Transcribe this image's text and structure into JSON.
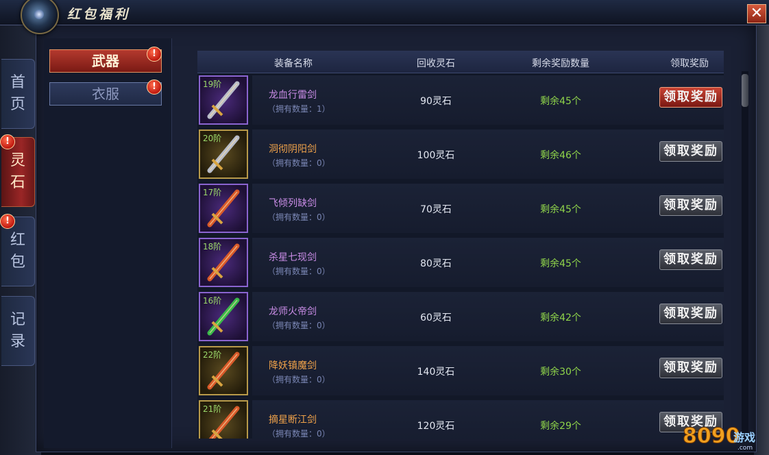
{
  "window": {
    "title": "红包福利",
    "close_label": "✕"
  },
  "side_tabs": [
    {
      "label_top": "首",
      "label_bottom": "页",
      "active": false,
      "badge": ""
    },
    {
      "label_top": "灵",
      "label_bottom": "石",
      "active": true,
      "badge": "!"
    },
    {
      "label_top": "红",
      "label_bottom": "包",
      "active": false,
      "badge": "!"
    },
    {
      "label_top": "记",
      "label_bottom": "录",
      "active": false,
      "badge": ""
    }
  ],
  "categories": {
    "weapon": {
      "label": "武器",
      "badge": "!"
    },
    "clothes": {
      "label": "衣服",
      "badge": "!"
    }
  },
  "table": {
    "headers": [
      "装备名称",
      "回收灵石",
      "剩余奖励数量",
      "领取奖励"
    ],
    "rows": [
      {
        "tier": "19阶",
        "name": "龙血行雷剑",
        "name_color": "#c98ce6",
        "owned": "（拥有数量：1）",
        "stone": "90灵石",
        "remain": "剩余45个",
        "claim": "领取奖励",
        "active": true,
        "frame": "purple"
      },
      {
        "tier": "20阶",
        "name": "洞彻阴阳剑",
        "name_color": "#f0a24a",
        "owned": "（拥有数量：0）",
        "stone": "100灵石",
        "remain": "剩余46个",
        "claim": "领取奖励",
        "active": false,
        "frame": "gold"
      },
      {
        "tier": "17阶",
        "name": "飞倾列缺剑",
        "name_color": "#c98ce6",
        "owned": "（拥有数量：0）",
        "stone": "70灵石",
        "remain": "剩余45个",
        "claim": "领取奖励",
        "active": false,
        "frame": "purple"
      },
      {
        "tier": "18阶",
        "name": "杀星七现剑",
        "name_color": "#c98ce6",
        "owned": "（拥有数量：0）",
        "stone": "80灵石",
        "remain": "剩余45个",
        "claim": "领取奖励",
        "active": false,
        "frame": "purple"
      },
      {
        "tier": "16阶",
        "name": "龙师火帝剑",
        "name_color": "#c98ce6",
        "owned": "（拥有数量：0）",
        "stone": "60灵石",
        "remain": "剩余42个",
        "claim": "领取奖励",
        "active": false,
        "frame": "purple"
      },
      {
        "tier": "22阶",
        "name": "降妖镇魔剑",
        "name_color": "#f0a24a",
        "owned": "（拥有数量：0）",
        "stone": "140灵石",
        "remain": "剩余30个",
        "claim": "领取奖励",
        "active": false,
        "frame": "gold"
      },
      {
        "tier": "21阶",
        "name": "摘星断江剑",
        "name_color": "#f0a24a",
        "owned": "（拥有数量：0）",
        "stone": "120灵石",
        "remain": "剩余29个",
        "claim": "领取奖励",
        "active": false,
        "frame": "gold"
      }
    ]
  },
  "watermark": {
    "text": "8090游戏",
    "sub": ".com"
  }
}
